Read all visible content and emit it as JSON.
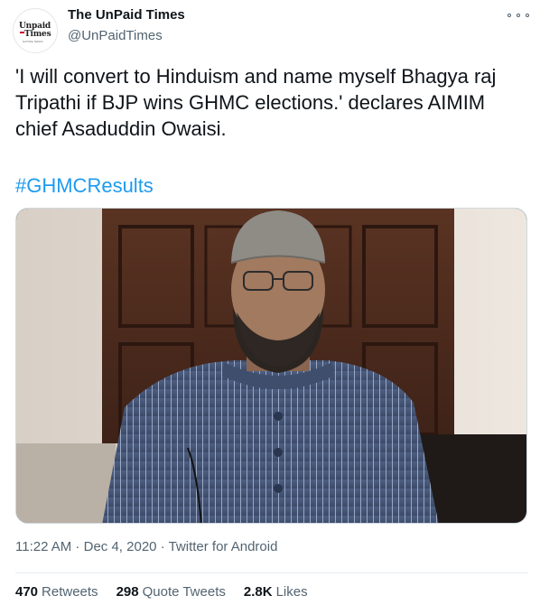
{
  "account": {
    "name": "The UnPaid Times",
    "handle": "@UnPaidTimes",
    "logo_top": "Unpaid",
    "logo_bottom": "Times",
    "logo_tiny": "SATIRE NEWS"
  },
  "tweet": {
    "text": "'I will convert to Hinduism and name myself Bhagya raj Tripathi if BJP wins GHMC elections.' declares AIMIM chief Asaduddin Owaisi.",
    "hashtag": "#GHMCResults"
  },
  "meta": {
    "time": "11:22 AM",
    "sep1": " · ",
    "date": "Dec 4, 2020",
    "sep2": " · ",
    "source": "Twitter for Android"
  },
  "stats": {
    "retweets_count": "470",
    "retweets_label": "Retweets",
    "quotes_count": "298",
    "quotes_label": "Quote Tweets",
    "likes_count": "2.8K",
    "likes_label": "Likes"
  },
  "colors": {
    "link": "#1d9bf0",
    "secondary": "#536471",
    "primary": "#0f1419"
  },
  "icons": {
    "more": "more-icon"
  }
}
